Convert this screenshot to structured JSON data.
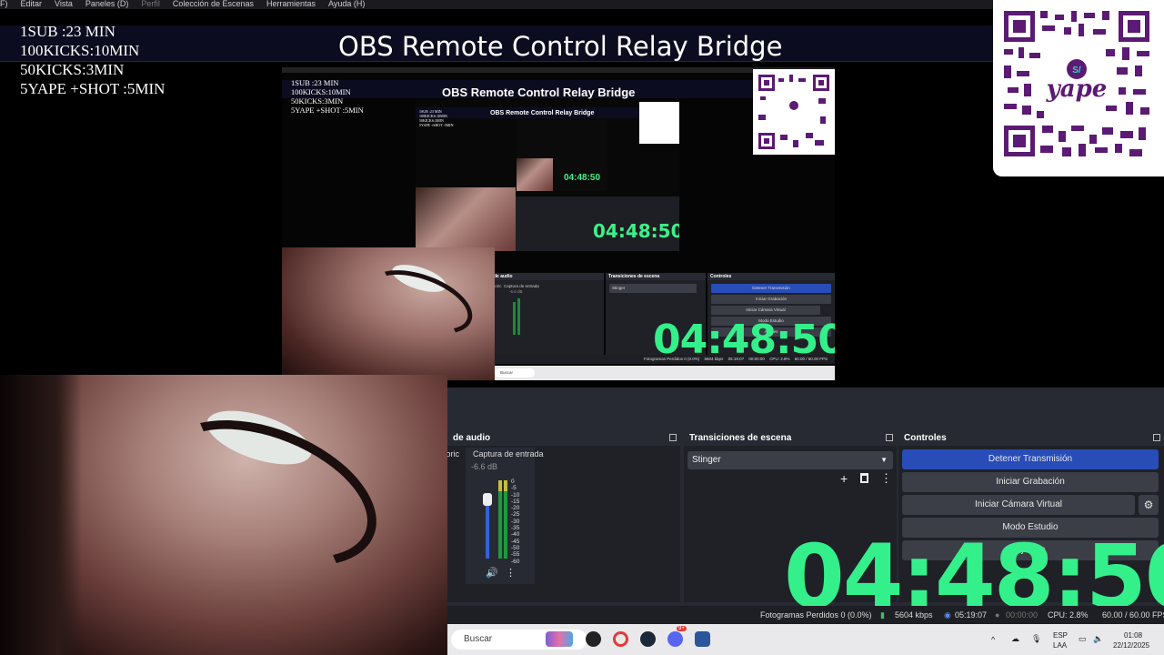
{
  "menubar": {
    "items": [
      "F)",
      "Editar",
      "Vista",
      "Paneles (D)",
      "Perfil",
      "Colección de Escenas",
      "Herramientas",
      "Ayuda (H)"
    ]
  },
  "banner": {
    "title": "OBS Remote Control Relay Bridge"
  },
  "overlay": {
    "lines": [
      "1SUB :23 MIN",
      "100KICKS:10MIN",
      "50KICKS:3MIN",
      "5YAPE +SHOT :5MIN"
    ]
  },
  "qr": {
    "brand": "yape",
    "badge": "S/"
  },
  "nested": {
    "title": "OBS Remote Control Relay Bridge",
    "clock": "04:48:50",
    "clock_small": "04:48:50",
    "clock_tiny": "04:48:50",
    "lines": [
      "1SUB :23 MIN",
      "100KICKS:10MIN",
      "50KICKS:3MIN",
      "5YAPE +SHOT :5MIN"
    ],
    "audio_title": "de audio",
    "audio_source": "Captura de entrada",
    "audio_left": "itoric",
    "audio_db": "-6.6 dB",
    "transitions_title": "Transiciones de escena",
    "transition": "Stinger",
    "controls_title": "Controles",
    "controls": [
      "Detener Transmisión",
      "Iniciar Grabación",
      "Iniciar Cámara Virtual",
      "Modo Estudio",
      "Ajustes"
    ],
    "status": "Fotogramas Perdidos 0 (0.0%)",
    "kbps": "5604 kbps",
    "time": "05:19:07",
    "rec": "00:00:00",
    "cpu": "CPU: 2.8%",
    "fps": "60.00 / 60.00 FPS",
    "search": "Buscar"
  },
  "obs": {
    "audio": {
      "title": "de audio",
      "left_label": "itoric",
      "source": "Captura de entrada",
      "db": "-6.6 dB",
      "scale": [
        "0",
        "-5",
        "-10",
        "-15",
        "-20",
        "-25",
        "-30",
        "-35",
        "-40",
        "-45",
        "-50",
        "-55",
        "-60"
      ],
      "left_scale": [
        "0",
        "5",
        "0",
        "5",
        "0",
        "5",
        "0",
        "5",
        "0",
        "5",
        "0",
        "5",
        "0"
      ]
    },
    "transitions": {
      "title": "Transiciones de escena",
      "selected": "Stinger"
    },
    "controls": {
      "title": "Controles",
      "stop_stream": "Detener Transmisión",
      "start_recording": "Iniciar Grabación",
      "start_virtual_cam": "Iniciar Cámara Virtual",
      "studio_mode": "Modo Estudio",
      "settings": "Ajustes"
    },
    "clock": "04:48:50",
    "status": {
      "dropped": "Fotogramas Perdidos 0 (0.0%)",
      "kbps": "5604 kbps",
      "stream_time": "05:19:07",
      "rec_time": "00:00:00",
      "cpu": "CPU: 2.8%",
      "fps": "60.00 / 60.00 FPS"
    }
  },
  "taskbar": {
    "search_placeholder": "Buscar",
    "lang": "ESP",
    "layout": "LAA",
    "time": "01:08",
    "date": "22/12/2025",
    "badge": "9+"
  },
  "colors": {
    "clock": "#34f08b",
    "primary_button": "#284cb8",
    "yape_purple": "#5b1a73"
  }
}
